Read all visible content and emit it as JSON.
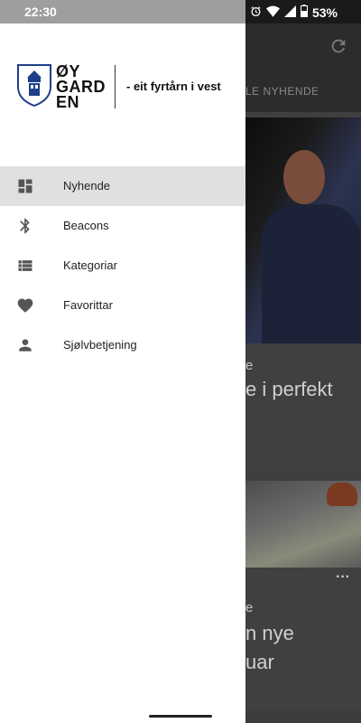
{
  "status_bar": {
    "time": "22:30",
    "battery": "53%"
  },
  "drawer": {
    "brand": {
      "line1": "ØY",
      "line2": "GARD",
      "line3": "EN",
      "slogan": "- eit fyrtårn i vest"
    },
    "menu": [
      {
        "label": "Nyhende",
        "icon": "dashboard-icon",
        "active": true
      },
      {
        "label": "Beacons",
        "icon": "bluetooth-icon",
        "active": false
      },
      {
        "label": "Kategoriar",
        "icon": "list-icon",
        "active": false
      },
      {
        "label": "Favorittar",
        "icon": "heart-icon",
        "active": false
      },
      {
        "label": "Sjølvbetjening",
        "icon": "person-icon",
        "active": false
      }
    ]
  },
  "background": {
    "tab_label": "LE NYHENDE",
    "card1": {
      "category": "e",
      "title": "e i perfekt"
    },
    "card2": {
      "more": "···",
      "category": "e",
      "title_line1": "n nye",
      "title_line2": "uar"
    }
  },
  "colors": {
    "brand_blue": "#1f3f88",
    "active_item_bg": "#e0e0e0"
  }
}
